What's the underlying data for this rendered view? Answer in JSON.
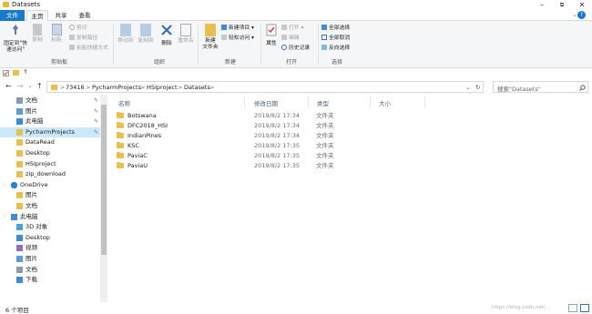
{
  "window": {
    "title": "Datasets",
    "controls": [
      "–",
      "⧉",
      "✕"
    ]
  },
  "ribbon_tabs": [
    "文件",
    "主页",
    "共享",
    "查看"
  ],
  "ribbon": {
    "clipboard": {
      "pin_label_1": "固定到\"快",
      "pin_label_2": "速访问\"",
      "copy": "复制",
      "paste": "粘贴",
      "cut": "剪切",
      "copy_path": "复制路径",
      "paste_shortcut": "粘贴快捷方式",
      "group": "剪贴板"
    },
    "organize": {
      "move_to": "移动到",
      "copy_to": "复制到",
      "delete": "删除",
      "rename": "重命名",
      "group": "组织"
    },
    "new": {
      "new_folder_1": "新建",
      "new_folder_2": "文件夹",
      "new_item": "新建项目",
      "easy_access": "轻松访问",
      "group": "新建"
    },
    "open": {
      "properties": "属性",
      "open": "打开",
      "edit": "编辑",
      "history": "历史记录",
      "group": "打开"
    },
    "select": {
      "select_all": "全部选择",
      "select_none": "全部取消",
      "invert": "反向选择",
      "group": "选择"
    }
  },
  "quick_access": {
    "glyph": "₹"
  },
  "address": {
    "segments": [
      "73416",
      "PycharmProjects",
      "HSIproject",
      "Datasets"
    ],
    "separator": ">",
    "search_placeholder": "搜索\"Datasets\""
  },
  "nav": {
    "items": [
      {
        "label": "文档",
        "icon": "doc-icon",
        "pinned": true
      },
      {
        "label": "图片",
        "icon": "image-icon",
        "pinned": true
      },
      {
        "label": "此电脑",
        "icon": "computer-icon",
        "pinned": true
      },
      {
        "label": "PycharmProjects",
        "icon": "folder-icon",
        "pinned": true,
        "selected": true
      },
      {
        "label": "DataRead",
        "icon": "folder-icon"
      },
      {
        "label": "Desktop",
        "icon": "folder-icon"
      },
      {
        "label": "HSIproject",
        "icon": "folder-icon"
      },
      {
        "label": "zip_download",
        "icon": "folder-icon"
      },
      {
        "label": "OneDrive",
        "icon": "cloud-icon",
        "section": true
      },
      {
        "label": "图片",
        "icon": "folder-icon"
      },
      {
        "label": "文档",
        "icon": "folder-icon"
      },
      {
        "label": "此电脑",
        "icon": "computer-icon",
        "section": true
      },
      {
        "label": "3D 对象",
        "icon": "3d-icon"
      },
      {
        "label": "Desktop",
        "icon": "desktop-icon"
      },
      {
        "label": "视频",
        "icon": "video-icon"
      },
      {
        "label": "图片",
        "icon": "image-icon"
      },
      {
        "label": "文档",
        "icon": "doc-icon"
      },
      {
        "label": "下载",
        "icon": "download-icon"
      }
    ]
  },
  "list": {
    "columns": [
      "名称",
      "修改日期",
      "类型",
      "大小"
    ],
    "rows": [
      {
        "name": "Botswana",
        "date": "2019/8/2 17:34",
        "type": "文件夹"
      },
      {
        "name": "DFC2018_HSI",
        "date": "2019/8/2 17:34",
        "type": "文件夹"
      },
      {
        "name": "IndianPines",
        "date": "2019/8/2 17:34",
        "type": "文件夹"
      },
      {
        "name": "KSC",
        "date": "2019/8/2 17:35",
        "type": "文件夹"
      },
      {
        "name": "PaviaC",
        "date": "2019/8/2 17:35",
        "type": "文件夹"
      },
      {
        "name": "PaviaU",
        "date": "2019/8/2 17:35",
        "type": "文件夹"
      }
    ]
  },
  "status": {
    "count": "6 个项目",
    "watermark": "https://blog.csdn.net/..."
  }
}
